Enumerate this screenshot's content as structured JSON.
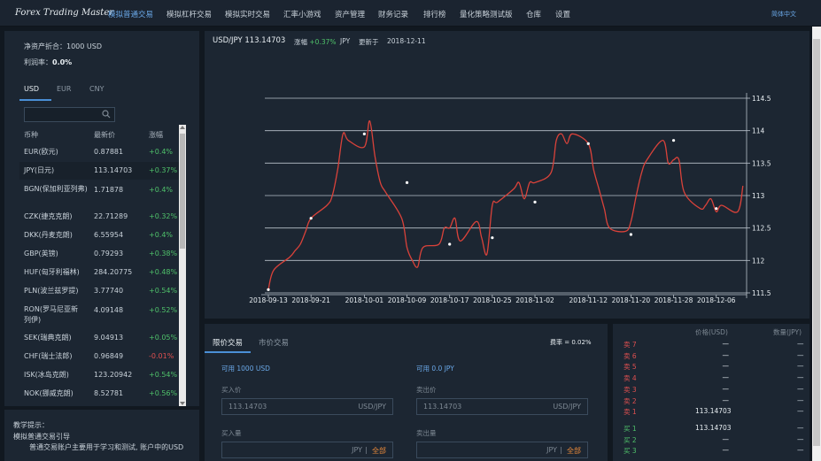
{
  "nav": {
    "brand": "Forex Trading Master",
    "items": [
      "模拟普通交易",
      "模拟杠杆交易",
      "模拟实时交易",
      "汇率小游戏",
      "资产管理",
      "财务记录",
      "排行榜",
      "量化策略测试版",
      "仓库",
      "设置"
    ],
    "active_index": 0,
    "language": "简体中文"
  },
  "account": {
    "net_label": "净资产折合：",
    "net_value": "1000 USD",
    "rate_label": "利润率：",
    "rate_value": "0.0%"
  },
  "currency_tabs": [
    "USD",
    "EUR",
    "CNY"
  ],
  "market": {
    "headers": [
      "币种",
      "最新价",
      "涨幅"
    ],
    "rows": [
      {
        "name": "EUR(欧元)",
        "price": "0.87881",
        "change": "+0.4%",
        "dir": "pos"
      },
      {
        "name": "JPY(日元)",
        "price": "113.14703",
        "change": "+0.37%",
        "dir": "pos"
      },
      {
        "name": "BGN(保加利亚列弗)",
        "price": "1.71878",
        "change": "+0.4%",
        "dir": "pos"
      },
      {
        "name": "CZK(捷克克朗)",
        "price": "22.71289",
        "change": "+0.32%",
        "dir": "pos"
      },
      {
        "name": "DKK(丹麦克朗)",
        "price": "6.55954",
        "change": "+0.4%",
        "dir": "pos"
      },
      {
        "name": "GBP(英镑)",
        "price": "0.79293",
        "change": "+0.38%",
        "dir": "pos"
      },
      {
        "name": "HUF(匈牙利福林)",
        "price": "284.20775",
        "change": "+0.48%",
        "dir": "pos"
      },
      {
        "name": "PLN(波兰兹罗提)",
        "price": "3.77740",
        "change": "+0.54%",
        "dir": "pos"
      },
      {
        "name": "RON(罗马尼亚新列伊)",
        "price": "4.09148",
        "change": "+0.52%",
        "dir": "pos"
      },
      {
        "name": "SEK(瑞典克朗)",
        "price": "9.04913",
        "change": "+0.05%",
        "dir": "pos"
      },
      {
        "name": "CHF(瑞士法郎)",
        "price": "0.96849",
        "change": "-0.01%",
        "dir": "neg"
      },
      {
        "name": "ISK(冰岛克朗)",
        "price": "123.20942",
        "change": "+0.54%",
        "dir": "pos"
      },
      {
        "name": "NOK(挪威克朗)",
        "price": "8.52781",
        "change": "+0.56%",
        "dir": "pos"
      }
    ]
  },
  "tips": {
    "title": "教学提示：",
    "line1": "模拟普通交易引导",
    "line2": "普通交易账户主要用于学习和测试, 账户中的USD"
  },
  "chart_header": {
    "pair": "USD/JPY 113.14703",
    "change_label": "涨幅",
    "change_value": "+0.37%",
    "currency": "JPY",
    "updated_label": "更新于",
    "updated_date": "2018-12-11"
  },
  "chart_data": {
    "type": "line",
    "x": [
      "2018-09-13",
      "2018-09-14",
      "2018-09-17",
      "2018-09-18",
      "2018-09-19",
      "2018-09-20",
      "2018-09-21",
      "2018-09-24",
      "2018-09-25",
      "2018-09-26",
      "2018-09-27",
      "2018-09-28",
      "2018-10-01",
      "2018-10-02",
      "2018-10-03",
      "2018-10-04",
      "2018-10-05",
      "2018-10-08",
      "2018-10-09",
      "2018-10-10",
      "2018-10-11",
      "2018-10-12",
      "2018-10-15",
      "2018-10-16",
      "2018-10-17",
      "2018-10-18",
      "2018-10-19",
      "2018-10-22",
      "2018-10-23",
      "2018-10-24",
      "2018-10-25",
      "2018-10-26",
      "2018-10-29",
      "2018-10-30",
      "2018-10-31",
      "2018-11-01",
      "2018-11-02",
      "2018-11-05",
      "2018-11-06",
      "2018-11-07",
      "2018-11-08",
      "2018-11-09",
      "2018-11-12",
      "2018-11-13",
      "2018-11-14",
      "2018-11-15",
      "2018-11-16",
      "2018-11-19",
      "2018-11-20",
      "2018-11-21",
      "2018-11-22",
      "2018-11-23",
      "2018-11-26",
      "2018-11-27",
      "2018-11-28",
      "2018-11-29",
      "2018-11-30",
      "2018-12-03",
      "2018-12-04",
      "2018-12-05",
      "2018-12-06",
      "2018-12-07",
      "2018-12-10",
      "2018-12-11"
    ],
    "values": [
      111.55,
      111.85,
      112.05,
      112.15,
      112.25,
      112.45,
      112.65,
      112.85,
      113.0,
      113.4,
      113.95,
      113.85,
      113.75,
      114.15,
      113.6,
      113.2,
      113.05,
      112.65,
      112.2,
      112.0,
      111.9,
      112.2,
      112.25,
      112.5,
      112.5,
      112.65,
      112.3,
      112.6,
      112.35,
      112.1,
      112.85,
      112.9,
      113.1,
      113.2,
      112.95,
      113.2,
      113.2,
      113.35,
      113.85,
      113.95,
      113.8,
      113.95,
      113.8,
      113.4,
      113.1,
      112.8,
      112.5,
      112.45,
      112.6,
      113.0,
      113.35,
      113.55,
      113.85,
      113.5,
      113.55,
      113.55,
      113.05,
      112.8,
      112.85,
      112.95,
      112.75,
      112.85,
      112.75,
      113.15
    ],
    "marked_points": [
      {
        "x": "2018-09-13",
        "y": 111.55
      },
      {
        "x": "2018-09-21",
        "y": 112.65
      },
      {
        "x": "2018-10-01",
        "y": 113.95
      },
      {
        "x": "2018-10-09",
        "y": 113.2
      },
      {
        "x": "2018-10-17",
        "y": 112.25
      },
      {
        "x": "2018-10-25",
        "y": 112.35
      },
      {
        "x": "2018-11-02",
        "y": 112.9
      },
      {
        "x": "2018-11-12",
        "y": 113.8
      },
      {
        "x": "2018-11-20",
        "y": 112.4
      },
      {
        "x": "2018-11-28",
        "y": 113.85
      },
      {
        "x": "2018-12-06",
        "y": 112.8
      }
    ],
    "x_ticks": [
      "2018-09-13",
      "2018-09-21",
      "2018-10-01",
      "2018-10-09",
      "2018-10-17",
      "2018-10-25",
      "2018-11-02",
      "2018-11-12",
      "2018-11-20",
      "2018-11-28",
      "2018-12-06"
    ],
    "y_ticks": [
      111.5,
      112,
      112.5,
      113,
      113.5,
      114,
      114.5
    ],
    "ylim": [
      111.5,
      114.5
    ],
    "y_axis_side": "right",
    "grid": true,
    "line_color": "#d9423a",
    "title": "",
    "xlabel": "",
    "ylabel": ""
  },
  "order": {
    "tabs": [
      "限价交易",
      "市价交易"
    ],
    "rate_text": "费率 = 0.02%",
    "buy_available": "可用 1000 USD",
    "sell_available": "可用 0.0 JPY",
    "buy_price_label": "买入价",
    "sell_price_label": "卖出价",
    "buy_price_value": "113.14703",
    "sell_price_value": "113.14703",
    "price_unit": "USD/JPY",
    "buy_amount_label": "买入量",
    "sell_amount_label": "卖出量",
    "amount_unit": "JPY",
    "all_label": "全部"
  },
  "book": {
    "price_header": "价格(USD)",
    "amount_header": "数量(JPY)",
    "sells": [
      {
        "label": "卖 7",
        "price": "—",
        "amount": "—"
      },
      {
        "label": "卖 6",
        "price": "—",
        "amount": "—"
      },
      {
        "label": "卖 5",
        "price": "—",
        "amount": "—"
      },
      {
        "label": "卖 4",
        "price": "—",
        "amount": "—"
      },
      {
        "label": "卖 3",
        "price": "—",
        "amount": "—"
      },
      {
        "label": "卖 2",
        "price": "—",
        "amount": "—"
      },
      {
        "label": "卖 1",
        "price": "113.14703",
        "amount": "—"
      }
    ],
    "buys": [
      {
        "label": "买 1",
        "price": "113.14703",
        "amount": "—"
      },
      {
        "label": "买 2",
        "price": "—",
        "amount": "—"
      },
      {
        "label": "买 3",
        "price": "—",
        "amount": "—"
      }
    ]
  },
  "colors": {
    "background": "#111820",
    "panel": "#1c2632",
    "accent": "#4a8fd6",
    "up": "#4fc16a",
    "down": "#e05050",
    "line": "#d9423a"
  }
}
